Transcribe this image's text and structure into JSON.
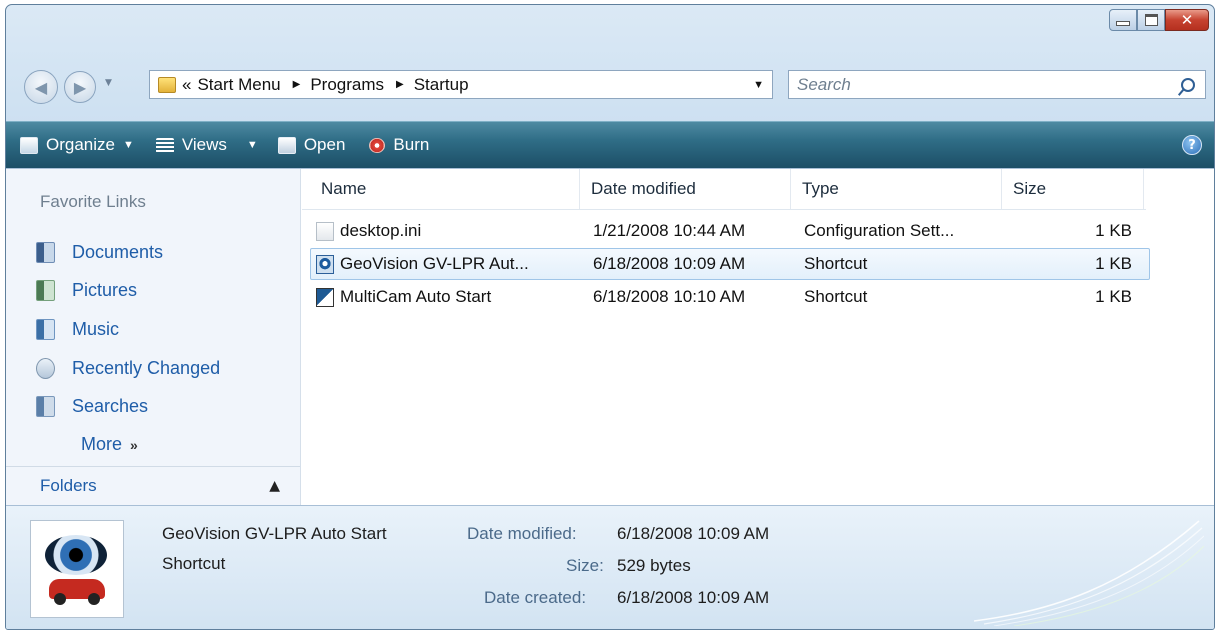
{
  "address": {
    "overflow": "«",
    "crumbs": [
      "Start Menu",
      "Programs",
      "Startup"
    ]
  },
  "search": {
    "placeholder": "Search"
  },
  "toolbar": {
    "organize": "Organize",
    "views": "Views",
    "open": "Open",
    "burn": "Burn",
    "help": "?"
  },
  "nav": {
    "heading": "Favorite Links",
    "links": [
      "Documents",
      "Pictures",
      "Music",
      "Recently Changed",
      "Searches"
    ],
    "more": "More",
    "more_chevron": "»",
    "folders": "Folders"
  },
  "columns": {
    "name": "Name",
    "date": "Date modified",
    "type": "Type",
    "size": "Size"
  },
  "files": [
    {
      "name": "desktop.ini",
      "date": "1/21/2008 10:44 AM",
      "type": "Configuration Sett...",
      "size": "1 KB",
      "icon": "ini-file-icon"
    },
    {
      "name": "GeoVision GV-LPR Aut...",
      "date": "6/18/2008 10:09 AM",
      "type": "Shortcut",
      "size": "1 KB",
      "icon": "geovision-shortcut-icon",
      "selected": true
    },
    {
      "name": "MultiCam Auto Start",
      "date": "6/18/2008 10:10 AM",
      "type": "Shortcut",
      "size": "1 KB",
      "icon": "multicam-shortcut-icon"
    }
  ],
  "details": {
    "name": "GeoVision GV-LPR Auto Start",
    "type": "Shortcut",
    "date_modified_label": "Date modified:",
    "date_modified": "6/18/2008 10:09 AM",
    "size_label": "Size:",
    "size": "529 bytes",
    "date_created_label": "Date created:",
    "date_created": "6/18/2008 10:09 AM"
  }
}
